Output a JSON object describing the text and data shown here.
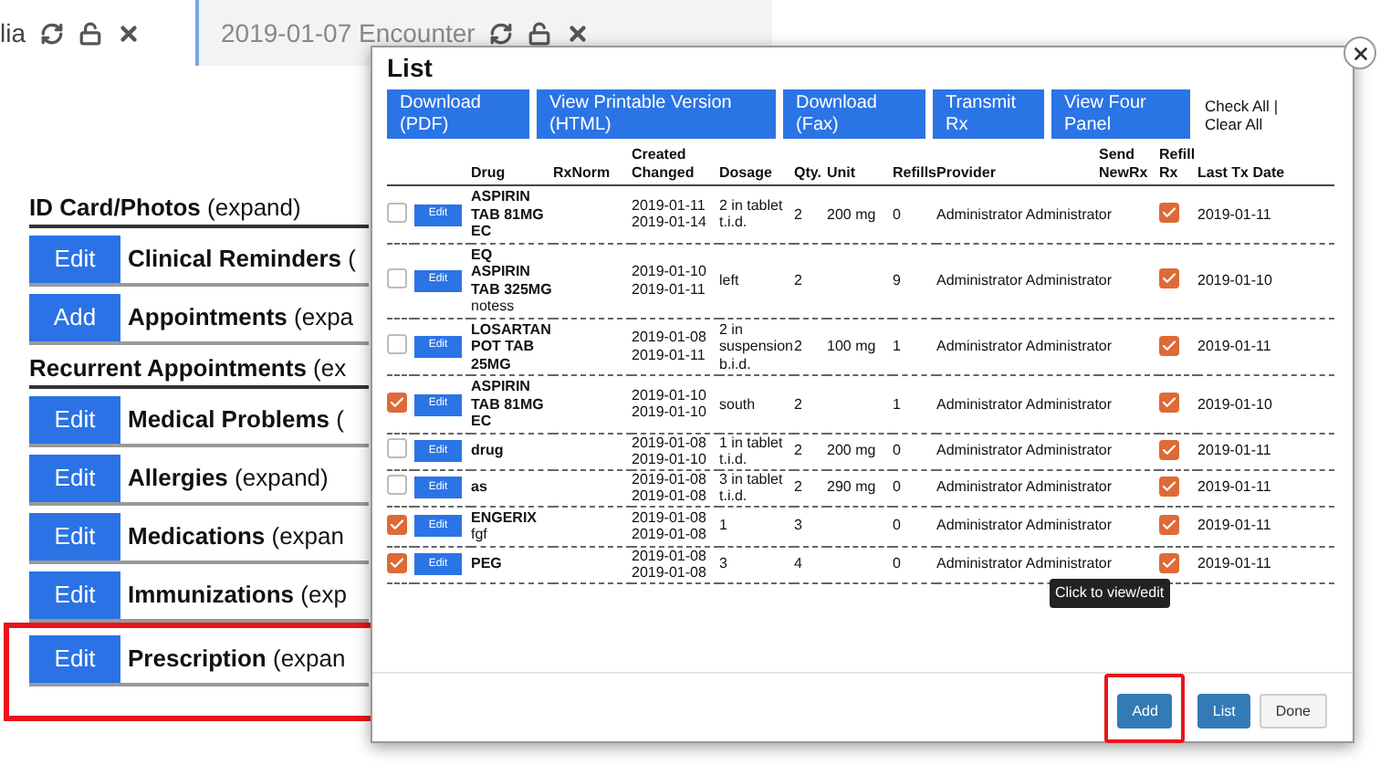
{
  "tabs": [
    {
      "label": "lia",
      "selected": false
    },
    {
      "label": "2019-01-07 Encounter",
      "selected": true
    }
  ],
  "sections": [
    {
      "kind": "header",
      "title": "ID Card/Photos",
      "hint": "(expand)",
      "highlighted": false
    },
    {
      "kind": "button",
      "button": "Edit",
      "title": "Clinical Reminders",
      "hint": "(",
      "highlighted": false
    },
    {
      "kind": "button",
      "button": "Add",
      "title": "Appointments",
      "hint": "(expa",
      "highlighted": false
    },
    {
      "kind": "header",
      "title": "Recurrent Appointments",
      "hint": "(ex",
      "highlighted": false
    },
    {
      "kind": "button",
      "button": "Edit",
      "title": "Medical Problems",
      "hint": "(",
      "highlighted": false
    },
    {
      "kind": "button",
      "button": "Edit",
      "title": "Allergies",
      "hint": "(expand)",
      "highlighted": false
    },
    {
      "kind": "button",
      "button": "Edit",
      "title": "Medications",
      "hint": "(expan",
      "highlighted": false
    },
    {
      "kind": "button",
      "button": "Edit",
      "title": "Immunizations",
      "hint": "(exp",
      "highlighted": false
    },
    {
      "kind": "button",
      "button": "Edit",
      "title": "Prescription",
      "hint": "(expan",
      "highlighted": true
    }
  ],
  "dialog": {
    "title": "List",
    "actions": [
      "Download (PDF)",
      "View Printable Version (HTML)",
      "Download (Fax)",
      "Transmit Rx",
      "View Four Panel"
    ],
    "check_all": "Check All",
    "separator": "|",
    "clear_all": "Clear All",
    "columns": [
      "Drug",
      "RxNorm",
      "Created Changed",
      "Dosage",
      "Qty.",
      "Unit",
      "Refills",
      "Provider",
      "Send NewRx",
      "Refill Rx",
      "Last Tx Date"
    ],
    "rows": [
      {
        "checked": false,
        "edit": "Edit",
        "drug": "ASPIRIN TAB 81MG EC",
        "created": "2019-01-11",
        "changed": "2019-01-14",
        "dosage": "2 in tablet t.i.d.",
        "qty": "2",
        "unit": "200 mg",
        "refills": "0",
        "provider": "Administrator Administrator",
        "refill_rx": true,
        "last_tx": "2019-01-11"
      },
      {
        "checked": false,
        "edit": "Edit",
        "drug": "EQ ASPIRIN TAB 325MG",
        "note": "notess",
        "created": "2019-01-10",
        "changed": "2019-01-11",
        "dosage": "left",
        "qty": "2",
        "refills": "9",
        "provider": "Administrator Administrator",
        "refill_rx": true,
        "last_tx": "2019-01-10"
      },
      {
        "checked": false,
        "edit": "Edit",
        "drug": "LOSARTAN POT TAB 25MG",
        "created": "2019-01-08",
        "changed": "2019-01-11",
        "dosage": "2 in suspension b.i.d.",
        "qty": "2",
        "unit": "100 mg",
        "refills": "1",
        "provider": "Administrator Administrator",
        "refill_rx": true,
        "last_tx": "2019-01-11"
      },
      {
        "checked": true,
        "edit": "Edit",
        "drug": "ASPIRIN TAB 81MG EC",
        "created": "2019-01-10",
        "changed": "2019-01-10",
        "dosage": "south",
        "qty": "2",
        "refills": "1",
        "provider": "Administrator Administrator",
        "refill_rx": true,
        "last_tx": "2019-01-10"
      },
      {
        "checked": false,
        "edit": "Edit",
        "drug": "drug",
        "created": "2019-01-08",
        "changed": "2019-01-10",
        "dosage": "1 in tablet t.i.d.",
        "qty": "2",
        "unit": "200 mg",
        "refills": "0",
        "provider": "Administrator Administrator",
        "refill_rx": true,
        "last_tx": "2019-01-11"
      },
      {
        "checked": false,
        "edit": "Edit",
        "drug": "as",
        "created": "2019-01-08",
        "changed": "2019-01-08",
        "dosage": "3 in tablet t.i.d.",
        "qty": "2",
        "unit": "290 mg",
        "refills": "0",
        "provider": "Administrator Administrator",
        "refill_rx": true,
        "last_tx": "2019-01-11"
      },
      {
        "checked": true,
        "edit": "Edit",
        "drug": "ENGERIX",
        "note": "fgf",
        "created": "2019-01-08",
        "changed": "2019-01-08",
        "dosage": "1",
        "qty": "3",
        "refills": "0",
        "provider": "Administrator Administrator",
        "refill_rx": true,
        "last_tx": "2019-01-11"
      },
      {
        "checked": true,
        "edit": "Edit",
        "drug": "PEG",
        "created": "2019-01-08",
        "changed": "2019-01-08",
        "dosage": "3",
        "qty": "4",
        "refills": "0",
        "provider": "Administrator Administrator",
        "refill_rx": true,
        "last_tx": "2019-01-11"
      }
    ],
    "tooltip": "Click to view/edit",
    "footer": [
      {
        "label": "Add",
        "kind": "primary",
        "highlighted": true
      },
      {
        "label": "List",
        "kind": "primary",
        "highlighted": false
      },
      {
        "label": "Done",
        "kind": "default",
        "highlighted": false
      }
    ]
  }
}
